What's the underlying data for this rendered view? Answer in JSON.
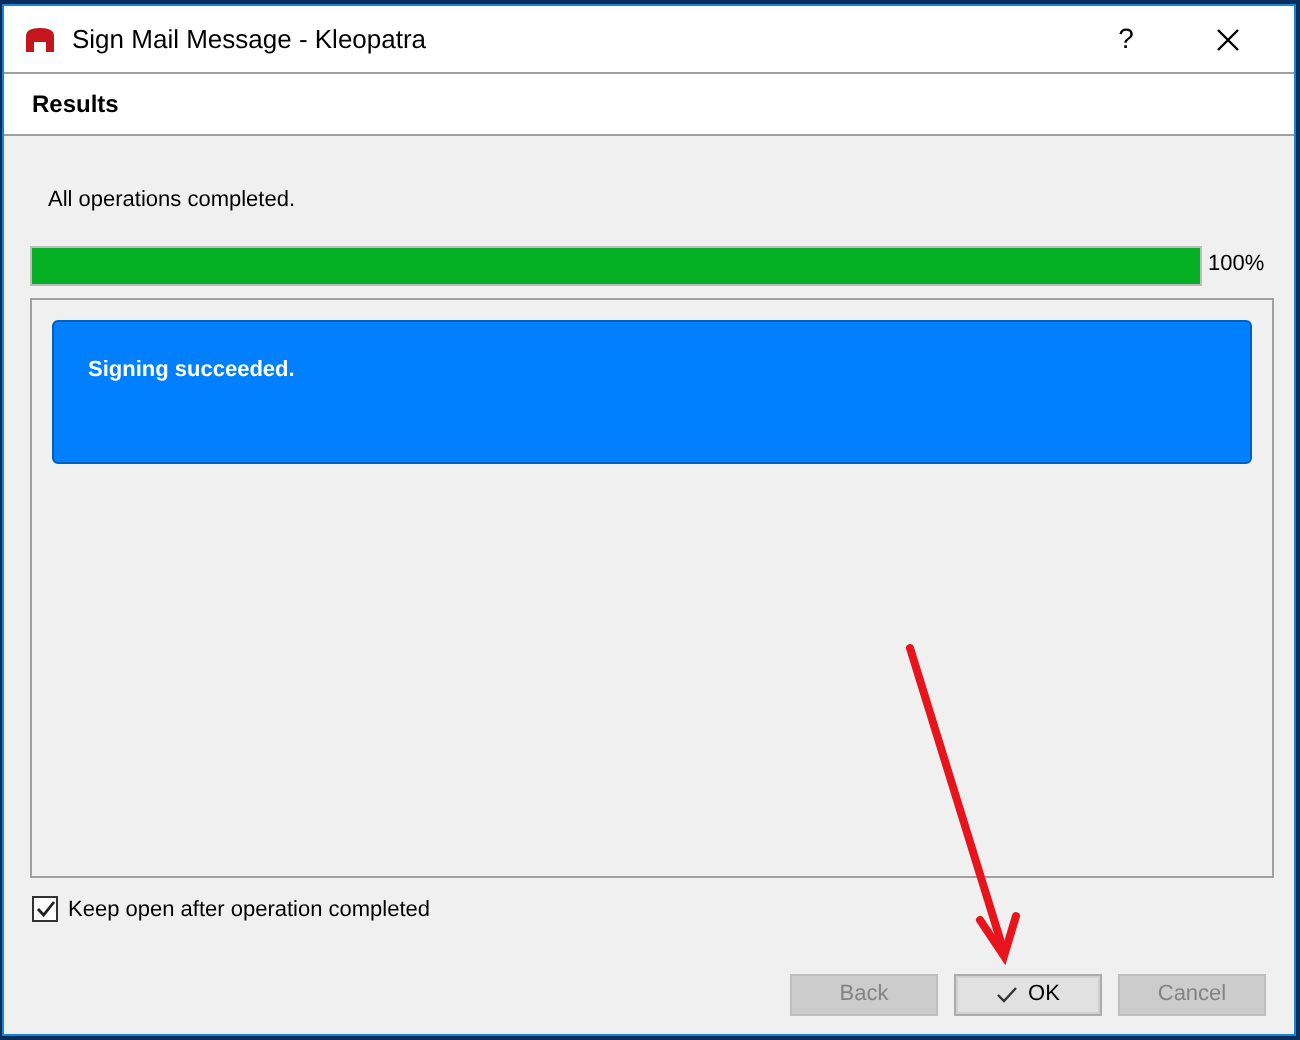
{
  "window": {
    "title": "Sign Mail Message - Kleopatra",
    "help": "?"
  },
  "header": {
    "title": "Results"
  },
  "status": "All operations completed.",
  "progress": {
    "level": 1,
    "reading": "100%"
  },
  "results": [
    {
      "text": "Signing succeeded.",
      "kind": "success"
    }
  ],
  "keep_open": {
    "label": "Keep open after operation completed",
    "checked": true
  },
  "buttons": [
    {
      "label": "Back",
      "disabled": true,
      "default": false
    },
    {
      "label": "OK",
      "disabled": false,
      "default": true
    },
    {
      "label": "Cancel",
      "disabled": true,
      "default": false
    }
  ]
}
